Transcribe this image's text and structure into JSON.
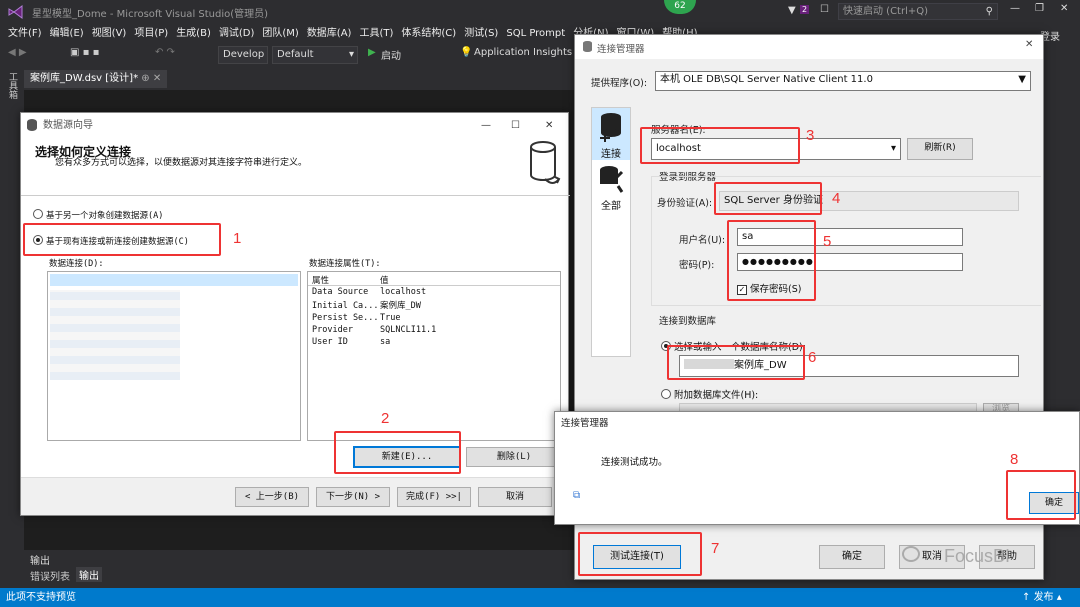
{
  "vs": {
    "title": "星型模型_Dome - Microsoft Visual Studio(管理员)",
    "badge": "62",
    "notif_count": "2",
    "quick_launch": "快速启动 (Ctrl+Q)",
    "menu": [
      "文件(F)",
      "编辑(E)",
      "视图(V)",
      "项目(P)",
      "生成(B)",
      "调试(D)",
      "团队(M)",
      "数据库(A)",
      "工具(T)",
      "体系结构(C)",
      "测试(S)",
      "SQL Prompt",
      "分析(N)",
      "窗口(W)",
      "帮助(H)"
    ],
    "login": "登录",
    "toolbar": {
      "develop": "Develop",
      "default": "Default",
      "start": "启动",
      "app_insights": "Application Insights"
    },
    "doc_tab": "案例库_DW.dsv [设计]*",
    "output_title": "输出",
    "bottom_tabs": [
      "错误列表",
      "输出"
    ],
    "status": "此项不支持预览",
    "publish": "发布",
    "left_strip": "工具箱"
  },
  "wizard": {
    "window_title": "数据源向导",
    "heading": "选择如何定义连接",
    "subtitle": "您有众多方式可以选择，以便数据源对其连接字符串进行定义。",
    "radio1": "基于另一个对象创建数据源(A)",
    "radio2": "基于现有连接或新连接创建数据源(C)",
    "conn_label": "数据连接(D):",
    "props_label": "数据连接属性(T):",
    "props_header": [
      "属性",
      "值"
    ],
    "props": [
      {
        "k": "Data Source",
        "v": "localhost"
      },
      {
        "k": "Initial Ca...",
        "v": "案例库_DW"
      },
      {
        "k": "Persist Se...",
        "v": "True"
      },
      {
        "k": "Provider",
        "v": "SQLNCLI11.1"
      },
      {
        "k": "User ID",
        "v": "sa"
      }
    ],
    "new_btn": "新建(E)...",
    "delete_btn": "删除(L)",
    "back_btn": "< 上一步(B)",
    "next_btn": "下一步(N) >",
    "finish_btn": "完成(F) >>|",
    "cancel_btn": "取消"
  },
  "conn_mgr": {
    "window_title": "连接管理器",
    "provider_label": "提供程序(O):",
    "provider": "本机 OLE DB\\SQL Server Native Client 11.0",
    "side_connect": "连接",
    "side_all": "全部",
    "server_label": "服务器名(E):",
    "server": "localhost",
    "refresh": "刷新(R)",
    "login_group": "登录到服务器",
    "auth_label": "身份验证(A):",
    "auth": "SQL Server 身份验证",
    "user_label": "用户名(U):",
    "user": "sa",
    "pwd_label": "密码(P):",
    "pwd": "●●●●●●●●●",
    "save_pwd": "保存密码(S)",
    "db_group": "连接到数据库",
    "db_radio": "选择或输入一个数据库名称(D):",
    "db_name": "案例库_DW",
    "attach_radio": "附加数据库文件(H):",
    "browse": "浏览",
    "test_btn": "测试连接(T)",
    "ok_btn": "确定",
    "cancel_btn": "取消",
    "help_btn": "帮助"
  },
  "msg": {
    "title": "连接管理器",
    "text": "连接测试成功。",
    "ok": "确定"
  },
  "annotations": [
    "1",
    "2",
    "3",
    "4",
    "5",
    "6",
    "7",
    "8"
  ],
  "watermark": "FocusBI",
  "colors": {
    "accent": "#007acc",
    "highlight": "#e33333",
    "vs_bg": "#2d2d30",
    "selection": "#cce8ff"
  }
}
